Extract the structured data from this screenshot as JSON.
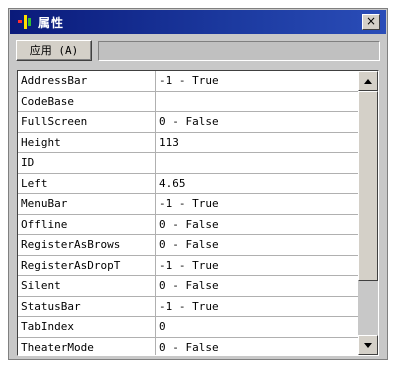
{
  "window": {
    "title": "属性",
    "close_label": "×",
    "accent": "#1c3aa0"
  },
  "toolbar": {
    "apply_label": "应用 (A)",
    "value_field": ""
  },
  "properties": [
    {
      "name": "AddressBar",
      "value": "-1 - True"
    },
    {
      "name": "CodeBase",
      "value": ""
    },
    {
      "name": "FullScreen",
      "value": "0 - False"
    },
    {
      "name": "Height",
      "value": "113"
    },
    {
      "name": "ID",
      "value": ""
    },
    {
      "name": "Left",
      "value": "4.65"
    },
    {
      "name": "MenuBar",
      "value": "-1 - True"
    },
    {
      "name": "Offline",
      "value": "0 - False"
    },
    {
      "name": "RegisterAsBrows",
      "value": "0 - False"
    },
    {
      "name": "RegisterAsDropT",
      "value": "-1 - True"
    },
    {
      "name": "Silent",
      "value": "0 - False"
    },
    {
      "name": "StatusBar",
      "value": "-1 - True"
    },
    {
      "name": "TabIndex",
      "value": "0"
    },
    {
      "name": "TheaterMode",
      "value": "0 - False"
    }
  ],
  "icons": {
    "app": "app-icon",
    "close": "close-icon",
    "scroll_up": "chevron-up-icon",
    "scroll_down": "chevron-down-icon"
  }
}
